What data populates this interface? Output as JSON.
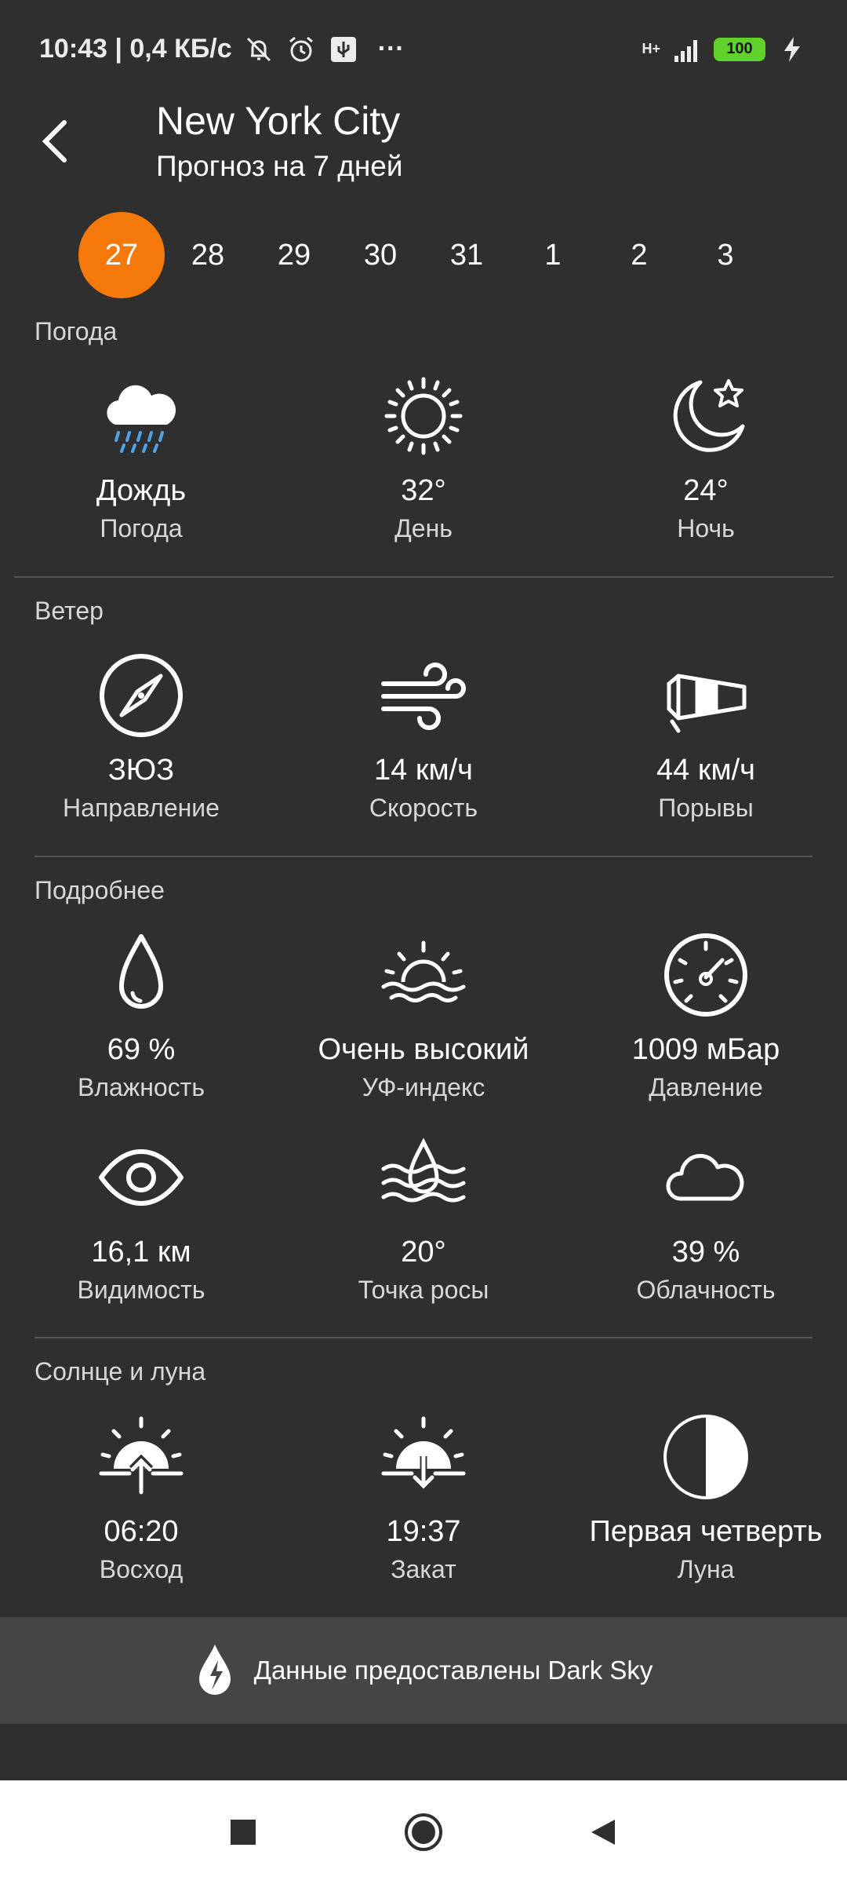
{
  "status_bar": {
    "time_speed": "10:43 | 0,4 КБ/с",
    "more": "···",
    "network": "H+",
    "battery": "100"
  },
  "header": {
    "title": "New York City",
    "subtitle": "Прогноз на 7 дней"
  },
  "days": [
    "27",
    "28",
    "29",
    "30",
    "31",
    "1",
    "2",
    "3"
  ],
  "selected_day": "27",
  "sections": {
    "weather": {
      "label": "Погода",
      "items": [
        {
          "value": "Дождь",
          "label": "Погода",
          "icon": "rain-cloud-icon"
        },
        {
          "value": "32°",
          "label": "День",
          "icon": "sun-icon"
        },
        {
          "value": "24°",
          "label": "Ночь",
          "icon": "moon-star-icon"
        }
      ]
    },
    "wind": {
      "label": "Ветер",
      "items": [
        {
          "value": "ЗЮЗ",
          "label": "Направление",
          "icon": "compass-icon"
        },
        {
          "value": "14 км/ч",
          "label": "Скорость",
          "icon": "wind-icon"
        },
        {
          "value": "44 км/ч",
          "label": "Порывы",
          "icon": "windsock-icon"
        }
      ]
    },
    "details": {
      "label": "Подробнее",
      "items": [
        {
          "value": "69 %",
          "label": "Влажность",
          "icon": "droplet-icon"
        },
        {
          "value": "Очень высокий",
          "label": "УФ-индекс",
          "icon": "sun-horizon-icon"
        },
        {
          "value": "1009 мБар",
          "label": "Давление",
          "icon": "gauge-icon"
        },
        {
          "value": "16,1 км",
          "label": "Видимость",
          "icon": "eye-icon"
        },
        {
          "value": "20°",
          "label": "Точка росы",
          "icon": "dew-point-icon"
        },
        {
          "value": "39 %",
          "label": "Облачность",
          "icon": "cloud-icon"
        }
      ]
    },
    "sun_moon": {
      "label": "Солнце и луна",
      "items": [
        {
          "value": "06:20",
          "label": "Восход",
          "icon": "sunrise-icon"
        },
        {
          "value": "19:37",
          "label": "Закат",
          "icon": "sunset-icon"
        },
        {
          "value": "Первая четверть",
          "label": "Луна",
          "icon": "half-moon-icon"
        }
      ]
    }
  },
  "attribution": "Данные предоставлены Dark Sky",
  "colors": {
    "accent": "#f5780a",
    "background": "#2f2f2f",
    "attribution_bg": "#454545",
    "rain": "#4ea3e8",
    "battery": "#5fd12a"
  }
}
